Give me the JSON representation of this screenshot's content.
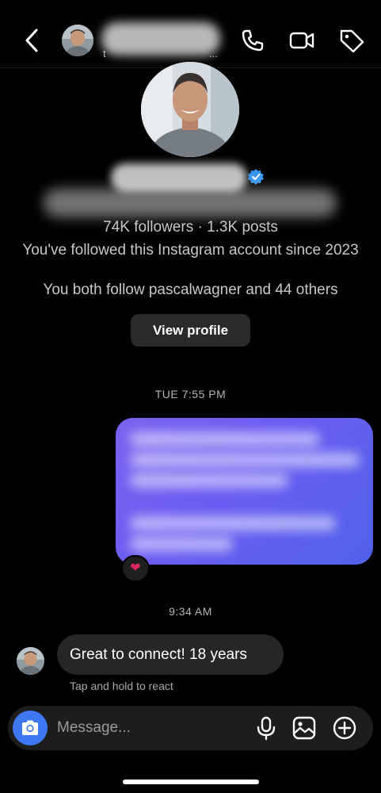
{
  "header": {
    "subtitle_start": "t",
    "subtitle_end": "..."
  },
  "profile": {
    "stats": "74K followers · 1.3K posts",
    "follow_since": "You've followed this Instagram account since 2023",
    "mutual": "You both follow pascalwagner and 44 others",
    "view_profile_label": "View profile"
  },
  "conversation": {
    "timestamp_1": "TUE 7:55 PM",
    "reaction": "❤",
    "timestamp_2": "9:34 AM",
    "received_message": "Great to connect! 18 years",
    "react_hint": "Tap and hold to react"
  },
  "composer": {
    "placeholder": "Message..."
  },
  "icons": {
    "back": "chevron-left-icon",
    "phone": "phone-icon",
    "video": "video-camera-icon",
    "tag": "tag-icon",
    "verified": "verified-badge-icon",
    "camera": "camera-icon",
    "mic": "microphone-icon",
    "gallery": "image-icon",
    "add": "plus-circle-icon"
  },
  "colors": {
    "background": "#000000",
    "bubble_received": "#262626",
    "bubble_sent_start": "#7a63f0",
    "bubble_sent_end": "#4f63ea",
    "camera_button": "#3d77f2",
    "verified": "#3897f0"
  }
}
